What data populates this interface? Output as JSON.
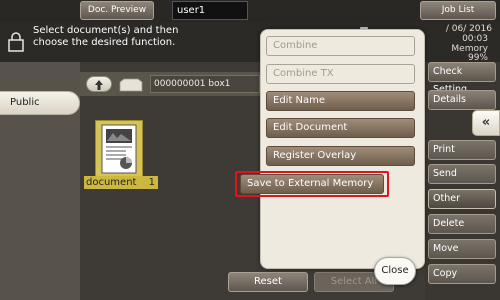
{
  "header": {
    "doc_preview_label": "Doc. Preview",
    "user_name": "user1",
    "job_list_label": "Job List"
  },
  "message": {
    "line1": "Select document(s) and then",
    "line2": "choose the desired function."
  },
  "status": {
    "date": "/ 06/ 2016",
    "time": "00:03",
    "memory_label": "Memory",
    "memory_percent": "99%"
  },
  "left": {
    "public_tab_label": "Public"
  },
  "path": {
    "box_text": "000000001  box1"
  },
  "document": {
    "name": "document",
    "count": "1"
  },
  "bottom": {
    "reset_label": "Reset",
    "select_all_label": "Select All"
  },
  "side_menu": {
    "check_setting": "Check Setting",
    "details": "Details",
    "collapse_arrow": "«",
    "print": "Print",
    "send": "Send",
    "other": "Other",
    "delete": "Delete",
    "move": "Move",
    "copy": "Copy"
  },
  "popup": {
    "items": [
      {
        "label": "Combine",
        "enabled": false
      },
      {
        "label": "Combine TX",
        "enabled": false
      },
      {
        "label": "Edit Name",
        "enabled": true
      },
      {
        "label": "Edit Document",
        "enabled": true
      },
      {
        "label": "Register Overlay",
        "enabled": true
      },
      {
        "label": "Save to External Memory",
        "enabled": true
      }
    ],
    "close_label": "Close",
    "highlight_color": "#e0141c"
  },
  "icons": [
    "document-lock-icon",
    "up-arrow-icon",
    "folder-icon",
    "document-thumbnail-icon",
    "collapse-arrow-icon"
  ]
}
